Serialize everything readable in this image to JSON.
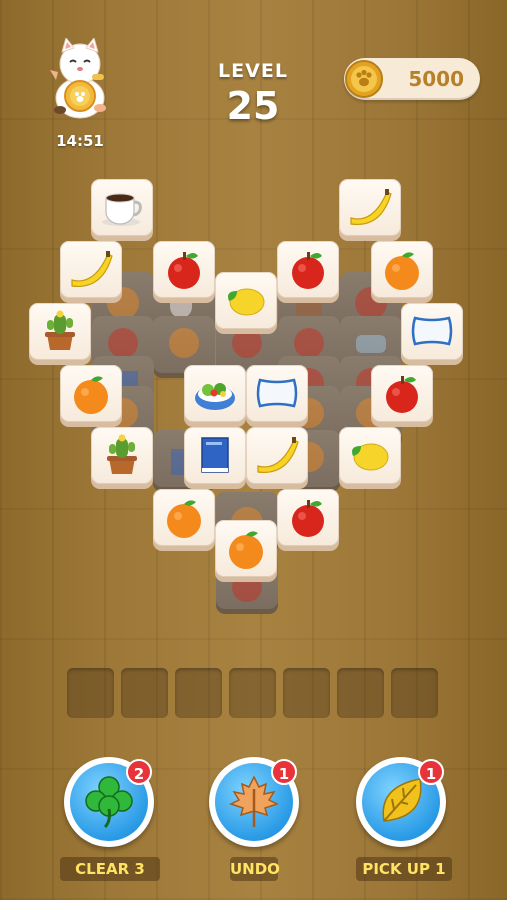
{
  "hud": {
    "timer": "14:51",
    "level_label": "LEVEL",
    "level_number": "25",
    "coins": "5000"
  },
  "board": {
    "shape": "heart",
    "tiles": [
      {
        "item": "coffee-cup",
        "state": "open"
      },
      {
        "item": "banana",
        "state": "open"
      },
      {
        "item": "banana",
        "state": "open"
      },
      {
        "item": "apple",
        "state": "open"
      },
      {
        "item": "apple",
        "state": "open"
      },
      {
        "item": "orange",
        "state": "open"
      },
      {
        "item": "lemon",
        "state": "open"
      },
      {
        "item": "cactus-pot",
        "state": "open"
      },
      {
        "item": "pillow",
        "state": "open"
      },
      {
        "item": "orange",
        "state": "open"
      },
      {
        "item": "salad-bowl",
        "state": "open"
      },
      {
        "item": "pillow",
        "state": "open"
      },
      {
        "item": "apple",
        "state": "open"
      },
      {
        "item": "cactus-pot",
        "state": "open"
      },
      {
        "item": "book",
        "state": "open"
      },
      {
        "item": "banana",
        "state": "open"
      },
      {
        "item": "lemon",
        "state": "open"
      },
      {
        "item": "orange",
        "state": "open"
      },
      {
        "item": "apple",
        "state": "open"
      },
      {
        "item": "orange",
        "state": "open"
      }
    ]
  },
  "tray": {
    "slots": 7,
    "filled": 0
  },
  "powerups": [
    {
      "label": "CLEAR 3",
      "count": "2",
      "icon": "clover-icon"
    },
    {
      "label": "UNDO",
      "count": "1",
      "icon": "maple-leaf-icon"
    },
    {
      "label": "PICK UP 1",
      "count": "1",
      "icon": "leaf-icon"
    }
  ],
  "colors": {
    "accent_blue": "#2a9be6",
    "badge_red": "#e8333a",
    "label_yellow": "#ffe266",
    "coin_gold": "#e3a322"
  }
}
